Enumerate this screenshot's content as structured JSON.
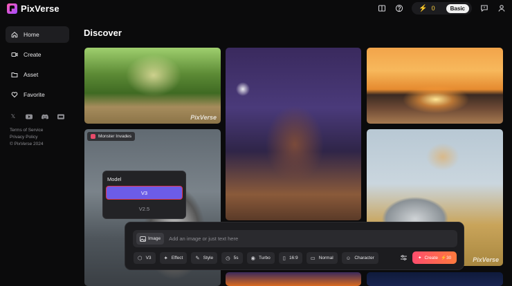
{
  "app": {
    "name": "PixVerse"
  },
  "header": {
    "credits": "0",
    "plan": "Basic"
  },
  "sidebar": {
    "items": [
      {
        "label": "Home",
        "icon": "home-icon",
        "active": true
      },
      {
        "label": "Create",
        "icon": "video-icon"
      },
      {
        "label": "Asset",
        "icon": "folder-icon"
      },
      {
        "label": "Favorite",
        "icon": "heart-icon"
      }
    ],
    "socials": [
      "x-icon",
      "youtube-icon",
      "discord-icon",
      "ai-icon"
    ],
    "footer": {
      "terms": "Terms of Service",
      "privacy": "Privacy Policy",
      "copyright": "© PixVerse 2024"
    }
  },
  "main": {
    "title": "Discover",
    "watermark": "PixVerse",
    "tag": "Monster Invades"
  },
  "model_popup": {
    "label": "Model",
    "options": [
      {
        "label": "V3",
        "selected": true
      },
      {
        "label": "V2.5"
      }
    ]
  },
  "create_bar": {
    "image_chip": "Image",
    "prompt_placeholder": "Add an image or just text here",
    "options": [
      {
        "label": "V3",
        "icon": "cube-icon"
      },
      {
        "label": "Effect",
        "icon": "wand-icon"
      },
      {
        "label": "Style",
        "icon": "brush-icon"
      },
      {
        "label": "5s",
        "icon": "clock-icon"
      },
      {
        "label": "Turbo",
        "icon": "eye-icon"
      },
      {
        "label": "16:9",
        "icon": "aspect-icon"
      },
      {
        "label": "Normal",
        "icon": "camera-icon"
      },
      {
        "label": "Character",
        "icon": "face-icon"
      }
    ],
    "create_label": "Create",
    "create_cost": "30"
  },
  "colors": {
    "accent": "#6c5ce7",
    "create": "#ff4d6d",
    "highlight": "#e0354e"
  }
}
